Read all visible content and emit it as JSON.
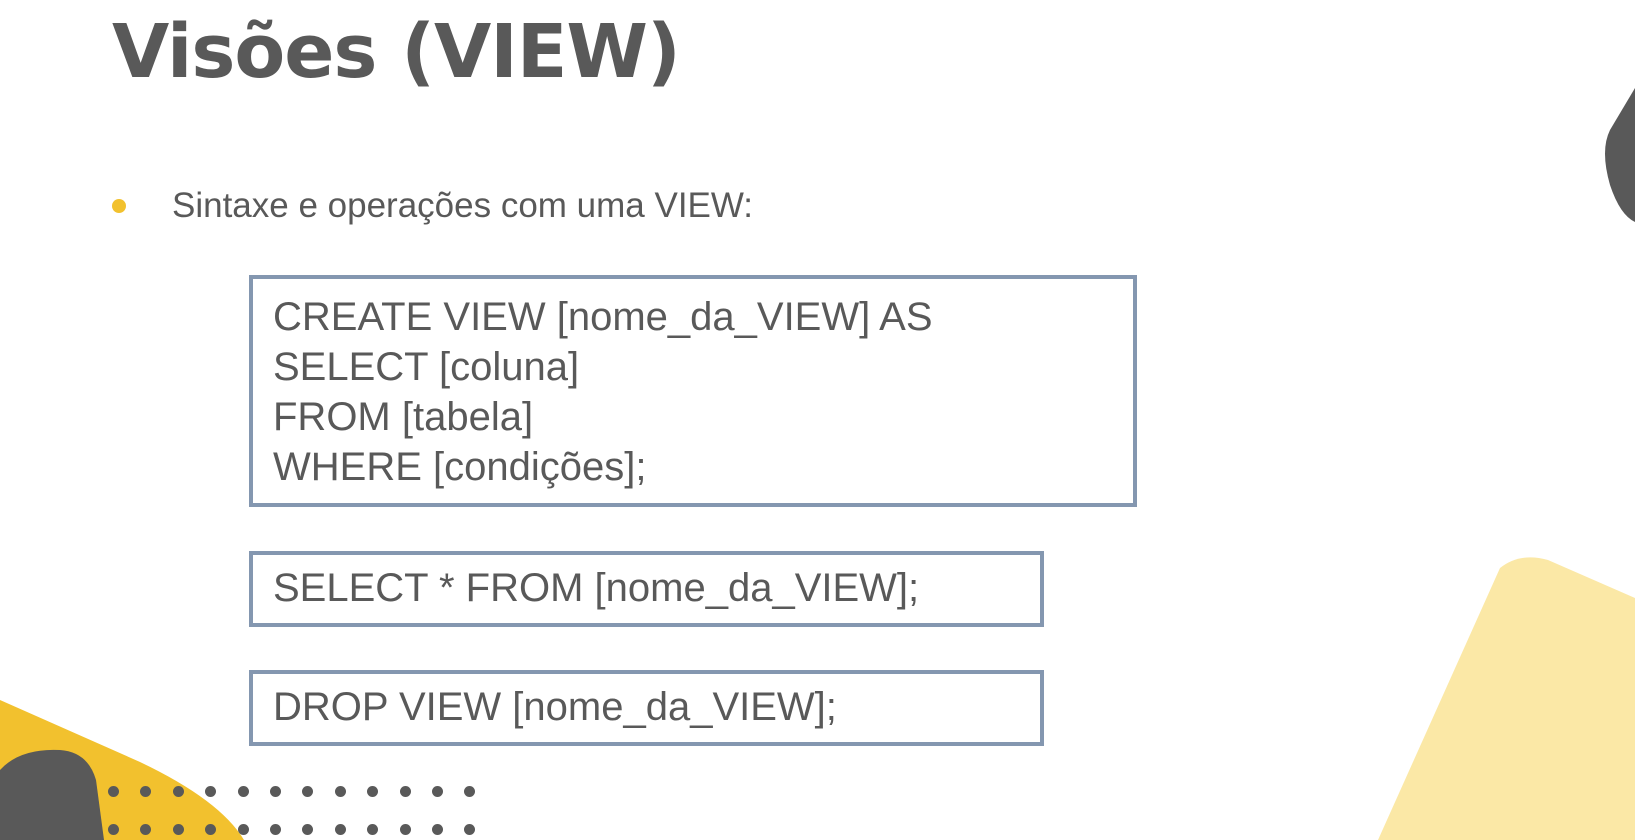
{
  "slide": {
    "title": "Visões (VIEW)",
    "bullet": "Sintaxe e operações com uma VIEW:"
  },
  "code_blocks": {
    "create": [
      "CREATE VIEW [nome_da_VIEW] AS",
      "SELECT [coluna]",
      "FROM [tabela]",
      "WHERE [condições];"
    ],
    "select": "SELECT * FROM [nome_da_VIEW];",
    "drop": "DROP VIEW [nome_da_VIEW];"
  },
  "colors": {
    "accent_yellow": "#f2c12e",
    "pale_yellow": "#fbe8a6",
    "dark_gray": "#595959",
    "box_border": "#8497b0"
  }
}
